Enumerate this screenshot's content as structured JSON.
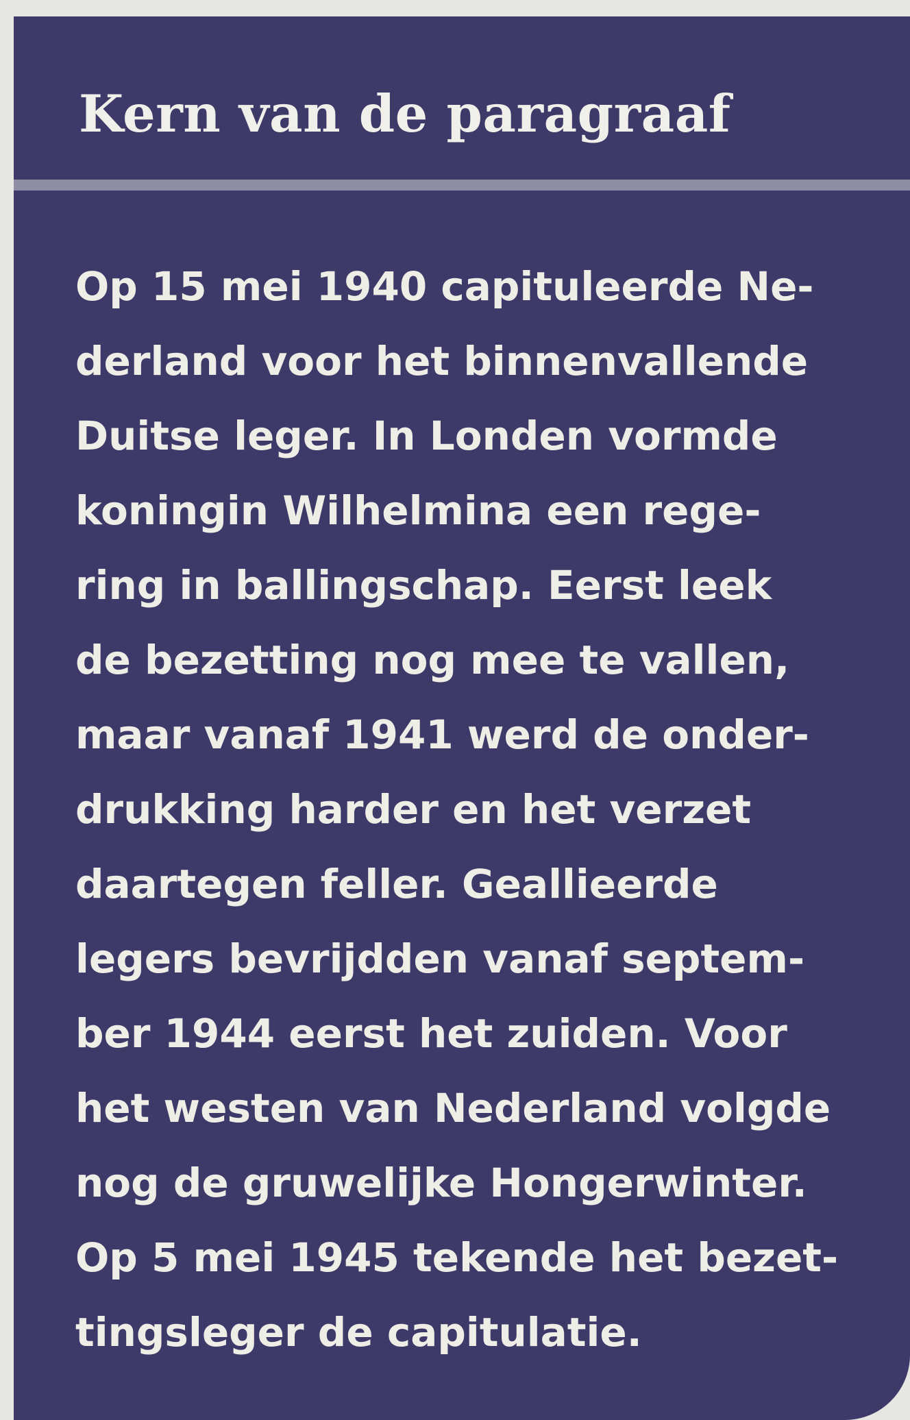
{
  "box": {
    "title": "Kern van de paragraaf",
    "lines": [
      "Op 15 mei 1940 capituleerde Ne-",
      "derland voor het binnenvallende",
      "Duitse leger. In Londen vormde",
      "koningin Wilhelmina een rege-",
      "ring in ballingschap. Eerst leek",
      "de bezetting nog mee te vallen,",
      "maar vanaf 1941 werd de onder-",
      "drukking harder en het verzet",
      "daartegen feller. Geallieerde",
      "legers bevrijdden vanaf septem-",
      "ber 1944 eerst het zuiden. Voor",
      "het westen van Nederland volgde",
      "nog de gruwelijke Hongerwinter.",
      "Op 5 mei 1945 tekende het bezet-",
      "tingsleger de capitulatie."
    ]
  },
  "colors": {
    "panel": "#3d3a69",
    "text": "#eeede6",
    "divider": "#8d8da4",
    "page": "#e7e7e2"
  }
}
